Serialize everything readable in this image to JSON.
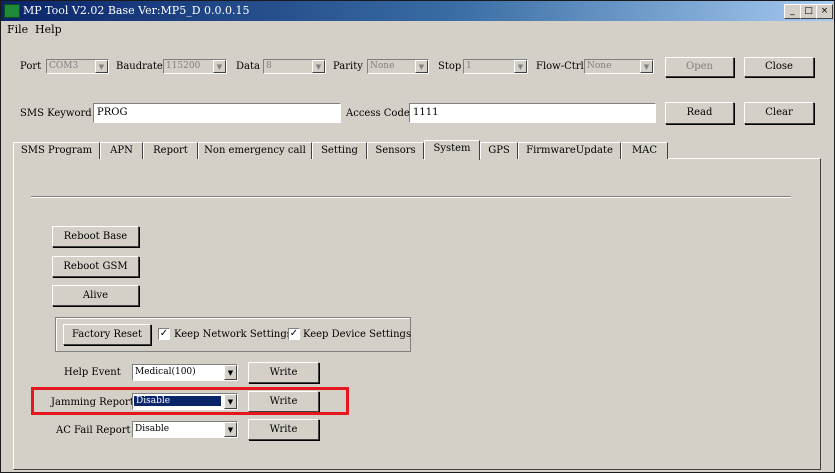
{
  "window": {
    "title": "MP Tool V2.02  Base Ver:MP5_D 0.0.0.15",
    "controls": [
      "_",
      "□",
      "×"
    ]
  },
  "menu": [
    "File",
    "Help"
  ],
  "connection": {
    "port_label": "Port",
    "port_value": "COM3",
    "baud_label": "Baudrate",
    "baud_value": "115200",
    "data_label": "Data",
    "data_value": "8",
    "parity_label": "Parity",
    "parity_value": "None",
    "stop_label": "Stop",
    "stop_value": "1",
    "flow_label": "Flow-Ctrl",
    "flow_value": "None",
    "open_label": "Open",
    "close_label": "Close"
  },
  "sms": {
    "keyword_label": "SMS Keyword",
    "keyword_value": "PROG",
    "access_label": "Access Code",
    "access_value": "1111",
    "read_label": "Read",
    "clear_label": "Clear"
  },
  "tabs": [
    "SMS Program",
    "APN",
    "Report",
    "Non emergency call",
    "Setting",
    "Sensors",
    "System",
    "GPS",
    "FirmwareUpdate",
    "MAC"
  ],
  "active_tab": "System",
  "system": {
    "reboot_base": "Reboot Base",
    "reboot_gsm": "Reboot GSM",
    "alive": "Alive",
    "factory_reset": "Factory Reset",
    "keep_network": "Keep Network Settings",
    "keep_device": "Keep Device Settings",
    "keep_network_checked": true,
    "keep_device_checked": true,
    "check_mark": "✓",
    "help_event_label": "Help Event",
    "help_event_value": "Medical(100)",
    "jamming_label": "Jamming Report",
    "jamming_value": "Disable",
    "ac_fail_label": "AC Fail Report",
    "ac_fail_value": "Disable",
    "write_label": "Write"
  },
  "colors": {
    "highlight": "#e5161d",
    "title_bar": "#0a246a",
    "face": "#d4d0c8"
  }
}
